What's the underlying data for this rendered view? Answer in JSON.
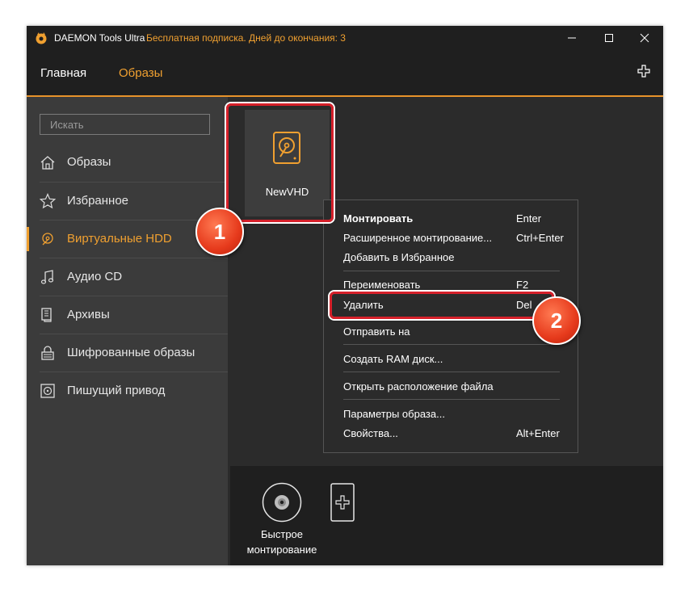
{
  "window": {
    "app_name": "DAEMON Tools Ultra",
    "trial_notice": "Бесплатная подписка. Дней до окончания: 3",
    "controls": [
      "minimize-icon",
      "maximize-icon",
      "close-icon"
    ]
  },
  "nav": {
    "tabs": [
      {
        "label": "Главная",
        "active": false
      },
      {
        "label": "Образы",
        "active": true
      }
    ],
    "add_icon": "plus-icon"
  },
  "sidebar": {
    "search_placeholder": "Искать",
    "items": [
      {
        "label": "Образы",
        "icon": "home-icon",
        "active": false
      },
      {
        "label": "Избранное",
        "icon": "star-icon",
        "active": false
      },
      {
        "label": "Виртуальные HDD",
        "icon": "hdd-icon",
        "active": true
      },
      {
        "label": "Аудио CD",
        "icon": "music-note-icon",
        "active": false
      },
      {
        "label": "Архивы",
        "icon": "archive-icon",
        "active": false
      },
      {
        "label": "Шифрованные образы",
        "icon": "lock-icon",
        "active": false
      },
      {
        "label": "Пишущий привод",
        "icon": "burner-icon",
        "active": false
      }
    ],
    "bottom_icons": [
      "license-icon",
      "help-icon",
      "search-icon"
    ]
  },
  "image_tile": {
    "label": "NewVHD",
    "icon": "hard-disk-icon"
  },
  "context_menu": {
    "groups": [
      [
        {
          "label": "Монтировать",
          "shortcut": "Enter",
          "bold": true
        },
        {
          "label": "Расширенное монтирование...",
          "shortcut": "Ctrl+Enter"
        },
        {
          "label": "Добавить в Избранное",
          "shortcut": ""
        }
      ],
      [
        {
          "label": "Переименовать",
          "shortcut": "F2"
        },
        {
          "label": "Удалить",
          "shortcut": "Del"
        },
        {
          "label": "Отправить на",
          "shortcut": ""
        }
      ],
      [
        {
          "label": "Создать RAM диск...",
          "shortcut": ""
        }
      ],
      [
        {
          "label": "Открыть расположение файла",
          "shortcut": ""
        }
      ],
      [
        {
          "label": "Параметры образа...",
          "shortcut": ""
        },
        {
          "label": "Свойства...",
          "shortcut": "Alt+Enter"
        }
      ]
    ]
  },
  "quick_mount": {
    "label_line1": "Быстрое",
    "label_line2": "монтирование"
  },
  "callouts": [
    "1",
    "2"
  ],
  "colors": {
    "accent": "#f0a030",
    "highlight": "#d6202a",
    "badge": "#e63a1c"
  }
}
